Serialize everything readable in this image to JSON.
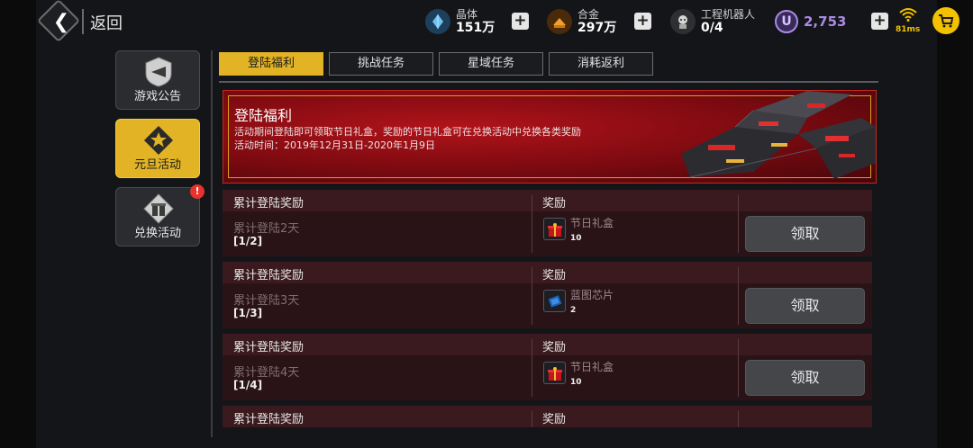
{
  "header": {
    "back_label": "返回",
    "back_icon": "chevron-left-icon",
    "resources": [
      {
        "name": "晶体",
        "value": "151万",
        "icon": "crystal-icon",
        "color": "#5fb6f0"
      },
      {
        "name": "合金",
        "value": "297万",
        "icon": "alloy-icon",
        "color": "#e8901e"
      },
      {
        "name": "工程机器人",
        "value": "0/4",
        "icon": "robot-icon",
        "color": "#d0d0d0"
      }
    ],
    "coin": {
      "icon": "u-coin-icon",
      "value": "2,753",
      "color": "#a98be6"
    },
    "ping": "81ms",
    "cart_icon": "cart-icon"
  },
  "nav": {
    "items": [
      {
        "label": "游戏公告",
        "icon": "announcement-icon",
        "active": false
      },
      {
        "label": "元旦活动",
        "icon": "star-badge-icon",
        "active": true
      },
      {
        "label": "兑换活动",
        "icon": "gift-exchange-icon",
        "active": false,
        "badge": "!"
      }
    ]
  },
  "tabs": [
    {
      "label": "登陆福利",
      "active": true
    },
    {
      "label": "挑战任务",
      "active": false
    },
    {
      "label": "星域任务",
      "active": false
    },
    {
      "label": "消耗返利",
      "active": false
    }
  ],
  "banner": {
    "title": "登陆福利",
    "description": "活动期间登陆即可领取节日礼盒，奖励的节日礼盒可在兑换活动中兑换各类奖励",
    "time": "活动时间：2019年12月31日-2020年1月9日"
  },
  "rewards": {
    "header_label": "累计登陆奖励",
    "reward_label": "奖励",
    "claim_label": "领取",
    "rows": [
      {
        "condition": "累计登陆2天",
        "progress": "[1/2]",
        "item": "节日礼盒",
        "count": "10",
        "icon": "gift-box-icon"
      },
      {
        "condition": "累计登陆3天",
        "progress": "[1/3]",
        "item": "蓝图芯片",
        "count": "2",
        "icon": "blueprint-chip-icon"
      },
      {
        "condition": "累计登陆4天",
        "progress": "[1/4]",
        "item": "节日礼盒",
        "count": "10",
        "icon": "gift-box-icon"
      }
    ]
  }
}
